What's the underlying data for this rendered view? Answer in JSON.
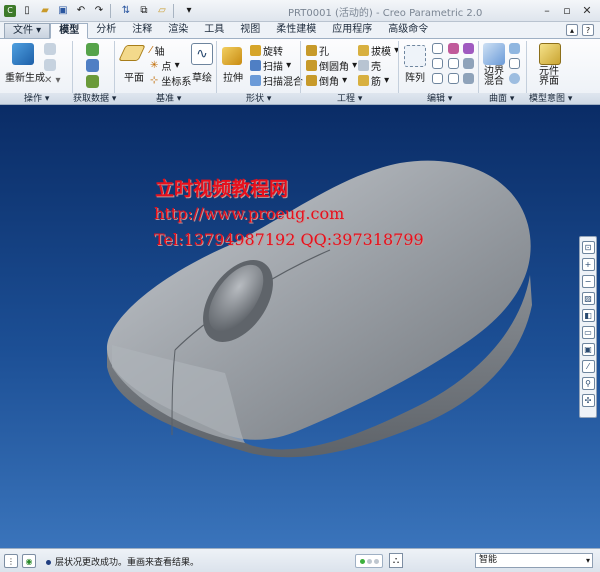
{
  "window": {
    "title": "PRT0001 (活动的) - Creo Parametric 2.0"
  },
  "tabs": [
    {
      "label": "文件 ▾"
    },
    {
      "label": "模型"
    },
    {
      "label": "分析"
    },
    {
      "label": "注释"
    },
    {
      "label": "渲染"
    },
    {
      "label": "工具"
    },
    {
      "label": "视图"
    },
    {
      "label": "柔性建模"
    },
    {
      "label": "应用程序"
    },
    {
      "label": "高级命令"
    }
  ],
  "ribbon": {
    "regenerate": "重新生成",
    "plane": "平面",
    "axis": "轴",
    "point": "点",
    "coordsys": "坐标系",
    "sketch": "草绘",
    "extrude": "拉伸",
    "revolve": "旋转",
    "sweep": "扫描",
    "swept_blend": "扫描混合",
    "hole": "孔",
    "round": "倒圆角",
    "chamfer": "倒角",
    "draft": "拔模",
    "shell": "壳",
    "rib": "筋",
    "pattern": "阵列",
    "boundary_blend": "边界\n混合",
    "component_interface": "元件\n界面"
  },
  "groups": {
    "operations": "操作 ▾",
    "get_data": "获取数据 ▾",
    "datum": "基准 ▾",
    "shapes": "形状 ▾",
    "engineering": "工程 ▾",
    "editing": "编辑 ▾",
    "surfaces": "曲面 ▾",
    "model_intent": "模型意图 ▾"
  },
  "watermark": {
    "line1": "立时视频教程网",
    "line2": "http://www.proeug.com",
    "line3": "Tel:13794987192  QQ:397318799"
  },
  "status": {
    "message": "层状况更改成功。重画来查看结果。",
    "filter_value": "智能"
  },
  "colors": {
    "viewport_top": "#0a2c66",
    "viewport_bottom": "#3a74bb",
    "watermark": "#e8101c",
    "model_gray": "#8d9197"
  }
}
